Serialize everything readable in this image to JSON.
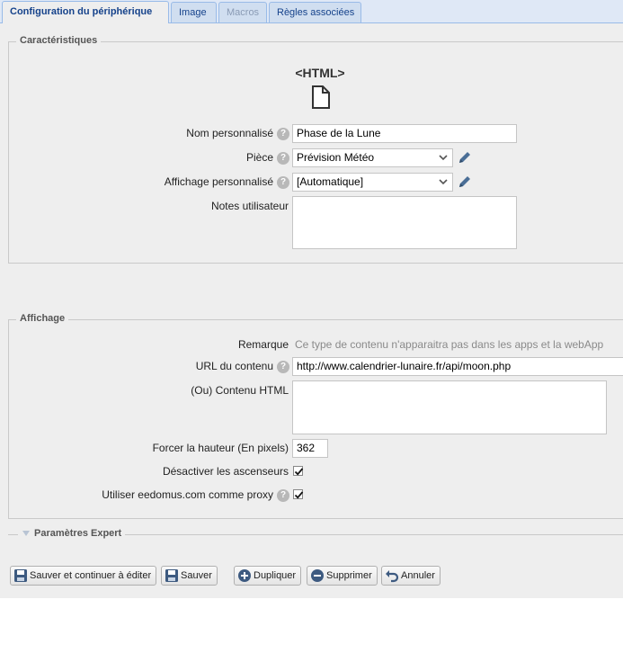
{
  "tabs": [
    {
      "label": "Configuration du périphérique"
    },
    {
      "label": "Image"
    },
    {
      "label": "Macros"
    },
    {
      "label": "Règles associées"
    }
  ],
  "characteristics": {
    "legend": "Caractéristiques",
    "type_label": "<HTML>",
    "type_icon": "file-icon",
    "name_label": "Nom personnalisé",
    "name_value": "Phase de la Lune",
    "room_label": "Pièce",
    "room_value": "Prévision Météo",
    "display_label": "Affichage personnalisé",
    "display_value": "[Automatique]",
    "notes_label": "Notes utilisateur",
    "notes_value": ""
  },
  "display": {
    "legend": "Affichage",
    "remark_label": "Remarque",
    "remark_text": "Ce type de contenu n'apparaitra pas dans les apps et la webApp",
    "url_label": "URL du contenu",
    "url_value": "http://www.calendrier-lunaire.fr/api/moon.php",
    "html_label": "(Ou) Contenu HTML",
    "html_value": "",
    "height_label": "Forcer la hauteur (En pixels)",
    "height_value": "362",
    "scroll_label": "Désactiver les ascenseurs",
    "scroll_checked": true,
    "proxy_label": "Utiliser eedomus.com comme proxy",
    "proxy_checked": true
  },
  "expert": {
    "label": "Paramètres Expert"
  },
  "buttons": {
    "save_continue": "Sauver et continuer à éditer",
    "save": "Sauver",
    "duplicate": "Dupliquer",
    "delete": "Supprimer",
    "cancel": "Annuler"
  },
  "colors": {
    "tab_text": "#15428b",
    "tab_border": "#99bbe8",
    "panel_bg": "#eeeeee",
    "help_icon": "#b8b8b8",
    "pencil_icon": "#4a6e96"
  }
}
